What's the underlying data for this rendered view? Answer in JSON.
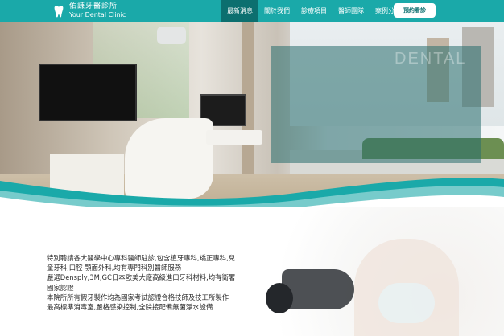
{
  "header": {
    "logo_zh": "佑謙牙醫診所",
    "logo_en": "Your Dental Clinic",
    "nav": [
      {
        "label": "最新消息",
        "active": true
      },
      {
        "label": "關於我們",
        "active": false
      },
      {
        "label": "診療項目",
        "active": false
      },
      {
        "label": "醫師團隊",
        "active": false
      },
      {
        "label": "案例分享",
        "active": false
      }
    ],
    "appointment_label": "預約看診"
  },
  "hero": {
    "watermark": "DENTAL"
  },
  "intro": {
    "lines": [
      "特別聘請各大醫學中心專科醫師駐診,包含植牙專科,矯正專科,兒",
      "童牙科,口腔 顎面外科,均有專門科別醫師服務",
      "嚴選Densply,3M,GC日本歐美大廠高級進口牙科材料,均有衛署",
      "國家認證",
      "本院所所有假牙製作均為國家考試認證合格技師及技工所製作",
      "最高標準消毒室,嚴格感染控制,全院接配備無菌淨水設備"
    ]
  },
  "colors": {
    "brand_teal": "#1aa9a9",
    "nav_active": "#0c6f6f"
  }
}
